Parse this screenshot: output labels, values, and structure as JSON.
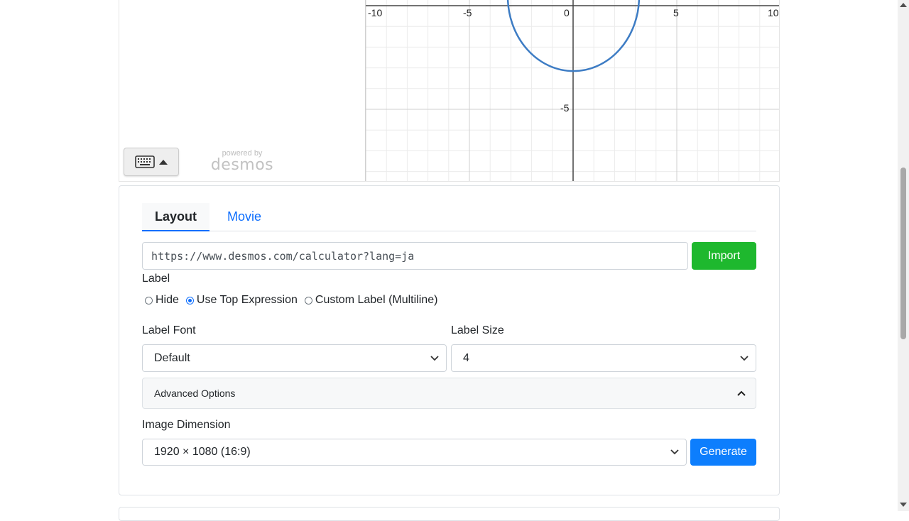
{
  "graph": {
    "x_ticks": [
      "-10",
      "-5",
      "0",
      "5",
      "10"
    ],
    "y_tick": "-5",
    "curve_color": "#3d7cc4"
  },
  "keypad": {
    "icon": "keyboard-icon",
    "toggle_icon": "caret-up-icon"
  },
  "branding": {
    "powered_by": "powered by",
    "brand": "desmos"
  },
  "tabs": [
    {
      "label": "Layout",
      "active": true
    },
    {
      "label": "Movie",
      "active": false
    }
  ],
  "import": {
    "url_value": "https://www.desmos.com/calculator?lang=ja",
    "button_label": "Import",
    "button_color": "#1eb82e"
  },
  "label_section": {
    "title": "Label",
    "options": [
      {
        "label": "Hide",
        "checked": false
      },
      {
        "label": "Use Top Expression",
        "checked": true
      },
      {
        "label": "Custom Label (Multiline)",
        "checked": false
      }
    ]
  },
  "label_font": {
    "title": "Label Font",
    "selected": "Default"
  },
  "label_size": {
    "title": "Label Size",
    "selected": "4"
  },
  "advanced": {
    "label": "Advanced Options",
    "icon": "chevron-up-icon"
  },
  "dimension": {
    "title": "Image Dimension",
    "selected": "1920 × 1080 (16:9)",
    "generate_label": "Generate",
    "generate_color": "#0d7efd"
  }
}
